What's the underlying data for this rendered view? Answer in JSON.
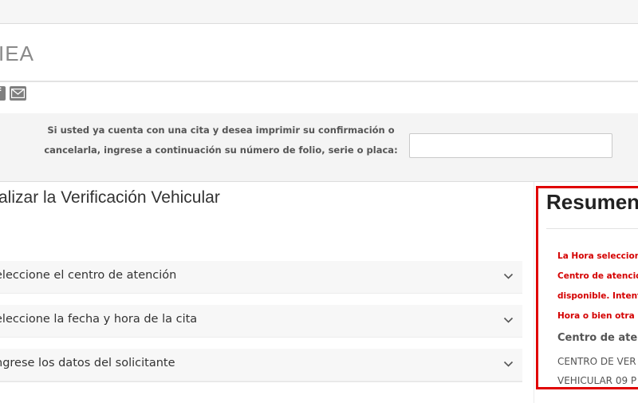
{
  "header": {
    "brand": "IEA"
  },
  "social": {
    "icons": [
      "facebook-icon",
      "email-icon"
    ],
    "facebook_glyph": "f"
  },
  "lookup": {
    "line1": "Si usted ya cuenta con una cita y desea imprimir su confirmación o",
    "line2": "cancelarla, ingrese a continuación su número de folio, serie o placa:",
    "input_value": ""
  },
  "main": {
    "heading": "alizar la Verificación Vehicular",
    "steps": [
      {
        "label": "eleccione el centro de atención"
      },
      {
        "label": "eleccione la fecha y hora de la cita"
      },
      {
        "label": "ngrese los datos del solicitante"
      }
    ]
  },
  "summary": {
    "title": "Resumen",
    "warning_lines": [
      "La Hora seleccion",
      "Centro de atenció",
      "disponible. Intent",
      "Hora o bien otra F"
    ],
    "center_label": "Centro de aten",
    "center_value_lines": [
      "CENTRO DE VER",
      "VEHICULAR 09 P"
    ]
  },
  "colors": {
    "accent_red": "#e00000",
    "warning_text": "#d40000",
    "icon_gray": "#7f7f7f"
  }
}
